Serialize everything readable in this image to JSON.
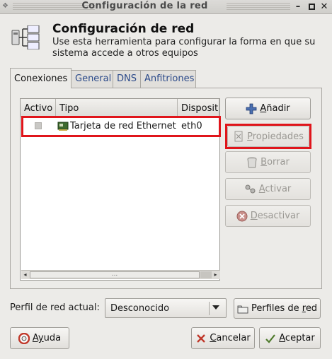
{
  "window": {
    "title": "Configuración de la red"
  },
  "header": {
    "title": "Configuración de red",
    "description": "Use esta herramienta para configurar la forma en que su sistema accede a otros equipos"
  },
  "tabs": [
    {
      "label": "Conexiones",
      "active": true
    },
    {
      "label": "General",
      "active": false
    },
    {
      "label": "DNS",
      "active": false
    },
    {
      "label": "Anfitriones",
      "active": false
    }
  ],
  "connections": {
    "columns": [
      "Activo",
      "Tipo",
      "Dispositi"
    ],
    "rows": [
      {
        "active": false,
        "type": "Tarjeta de red Ethernet",
        "device": "eth0",
        "icon": "ethernet-card-icon"
      }
    ],
    "scroll_thumb": "..."
  },
  "actions": {
    "add": {
      "prefix": "",
      "mnemonic": "A",
      "rest": "ñadir",
      "enabled": true
    },
    "properties": {
      "prefix": "",
      "mnemonic": "P",
      "rest": "ropiedades",
      "enabled": false
    },
    "delete": {
      "prefix": "",
      "mnemonic": "B",
      "rest": "orrar",
      "enabled": false
    },
    "activate": {
      "prefix": "",
      "mnemonic": "A",
      "rest": "ctivar",
      "enabled": false
    },
    "deactivate": {
      "prefix": "",
      "mnemonic": "D",
      "rest": "esactivar",
      "enabled": false
    }
  },
  "profile": {
    "label": "Perfil de red actual:",
    "value": "Desconocido",
    "profiles_button": {
      "prefix": "Perfiles de ",
      "mnemonic": "r",
      "rest": "ed"
    }
  },
  "footer": {
    "help": {
      "prefix": "",
      "mnemonic": "Ay",
      "rest": "uda"
    },
    "cancel": {
      "prefix": "",
      "mnemonic": "C",
      "rest": "ancelar"
    },
    "accept": {
      "prefix": "",
      "mnemonic": "A",
      "rest": "ceptar"
    }
  },
  "colors": {
    "highlight": "#e0151b",
    "link_tab": "#2b4a8a",
    "window_bg": "#ecebe8"
  }
}
